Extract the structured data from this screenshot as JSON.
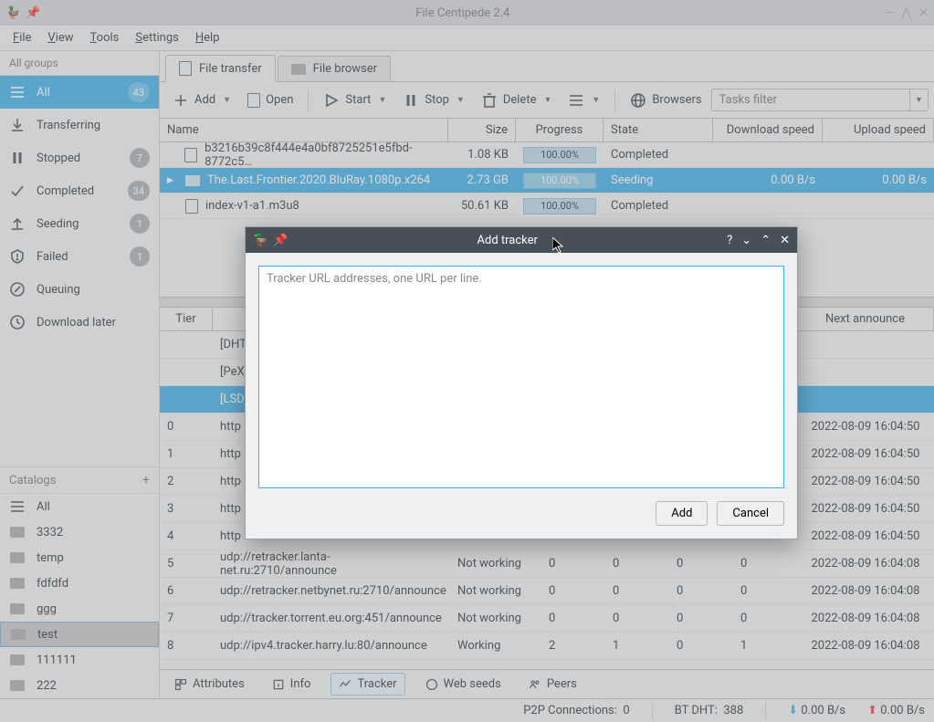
{
  "window_title": "File Centipede 2.4",
  "menu": {
    "file": "File",
    "view": "View",
    "tools": "Tools",
    "settings": "Settings",
    "help": "Help"
  },
  "sidebar": {
    "groups_header": "All groups",
    "items": [
      {
        "label": "All",
        "badge": "43"
      },
      {
        "label": "Transferring",
        "badge": ""
      },
      {
        "label": "Stopped",
        "badge": "7"
      },
      {
        "label": "Completed",
        "badge": "34"
      },
      {
        "label": "Seeding",
        "badge": "1"
      },
      {
        "label": "Failed",
        "badge": "1"
      },
      {
        "label": "Queuing",
        "badge": ""
      },
      {
        "label": "Download later",
        "badge": ""
      }
    ],
    "catalogs_header": "Catalogs",
    "catalogs": [
      {
        "label": "All"
      },
      {
        "label": "3332"
      },
      {
        "label": "temp"
      },
      {
        "label": "fdfdfd"
      },
      {
        "label": "ggg"
      },
      {
        "label": "test"
      },
      {
        "label": "111111"
      },
      {
        "label": "222"
      }
    ]
  },
  "main_tabs": {
    "transfer": "File transfer",
    "browser": "File browser"
  },
  "toolbar": {
    "add": "Add",
    "open": "Open",
    "start": "Start",
    "stop": "Stop",
    "delete": "Delete",
    "browsers": "Browsers",
    "filter_placeholder": "Tasks filter"
  },
  "columns": {
    "name": "Name",
    "size": "Size",
    "progress": "Progress",
    "state": "State",
    "dl": "Download speed",
    "ul": "Upload speed"
  },
  "tasks": [
    {
      "name": "b3216b39c8f444e4a0bf8725251e5fbd-8772c5…",
      "size": "1.08 KB",
      "progress": "100.00%",
      "state": "Completed",
      "dl": "",
      "ul": ""
    },
    {
      "name": "The.Last.Frontier.2020.BluRay.1080p.x264",
      "size": "2.73 GB",
      "progress": "100.00%",
      "state": "Seeding",
      "dl": "0.00 B/s",
      "ul": "0.00 B/s"
    },
    {
      "name": "index-v1-a1.m3u8",
      "size": "50.61 KB",
      "progress": "100.00%",
      "state": "Completed",
      "dl": "",
      "ul": ""
    }
  ],
  "tracker_cols": {
    "tier": "Tier",
    "next": "Next announce"
  },
  "trackers": [
    {
      "tier": "",
      "url": "[DHT]",
      "status": "",
      "a": "",
      "b": "",
      "c": "",
      "d": "",
      "next": ""
    },
    {
      "tier": "",
      "url": "[PeX]",
      "status": "",
      "a": "",
      "b": "",
      "c": "",
      "d": "",
      "next": ""
    },
    {
      "tier": "",
      "url": "[LSD]",
      "status": "",
      "a": "",
      "b": "",
      "c": "",
      "d": "",
      "next": ""
    },
    {
      "tier": "0",
      "url": "http",
      "status": "",
      "a": "",
      "b": "",
      "c": "",
      "d": "",
      "next": "2022-08-09 16:04:50"
    },
    {
      "tier": "1",
      "url": "http",
      "status": "",
      "a": "",
      "b": "",
      "c": "",
      "d": "",
      "next": "2022-08-09 16:04:50"
    },
    {
      "tier": "2",
      "url": "http",
      "status": "",
      "a": "",
      "b": "",
      "c": "",
      "d": "",
      "next": "2022-08-09 16:04:50"
    },
    {
      "tier": "3",
      "url": "http",
      "status": "",
      "a": "",
      "b": "",
      "c": "",
      "d": "",
      "next": "2022-08-09 16:04:50"
    },
    {
      "tier": "4",
      "url": "http",
      "status": "",
      "a": "",
      "b": "",
      "c": "",
      "d": "",
      "next": "2022-08-09 16:04:50"
    },
    {
      "tier": "5",
      "url": "udp://retracker.lanta-net.ru:2710/announce",
      "status": "Not working",
      "a": "0",
      "b": "0",
      "c": "0",
      "d": "0",
      "next": "2022-08-09 16:04:08"
    },
    {
      "tier": "6",
      "url": "udp://retracker.netbynet.ru:2710/announce",
      "status": "Not working",
      "a": "0",
      "b": "0",
      "c": "0",
      "d": "0",
      "next": "2022-08-09 16:04:08"
    },
    {
      "tier": "7",
      "url": "udp://tracker.torrent.eu.org:451/announce",
      "status": "Not working",
      "a": "0",
      "b": "0",
      "c": "0",
      "d": "0",
      "next": "2022-08-09 16:04:08"
    },
    {
      "tier": "8",
      "url": "udp://ipv4.tracker.harry.lu:80/announce",
      "status": "Working",
      "a": "2",
      "b": "1",
      "c": "0",
      "d": "1",
      "next": "2022-08-09 16:04:08"
    }
  ],
  "bottom_tabs": {
    "attributes": "Attributes",
    "info": "Info",
    "tracker": "Tracker",
    "webseeds": "Web seeds",
    "peers": "Peers"
  },
  "status": {
    "p2p_label": "P2P Connections:",
    "p2p": "0",
    "dht_label": "BT DHT:",
    "dht": "388",
    "dl": "0.00 B/s",
    "ul": "0.00 B/s"
  },
  "dialog": {
    "title": "Add tracker",
    "placeholder": "Tracker URL addresses, one URL per line.",
    "add": "Add",
    "cancel": "Cancel"
  }
}
